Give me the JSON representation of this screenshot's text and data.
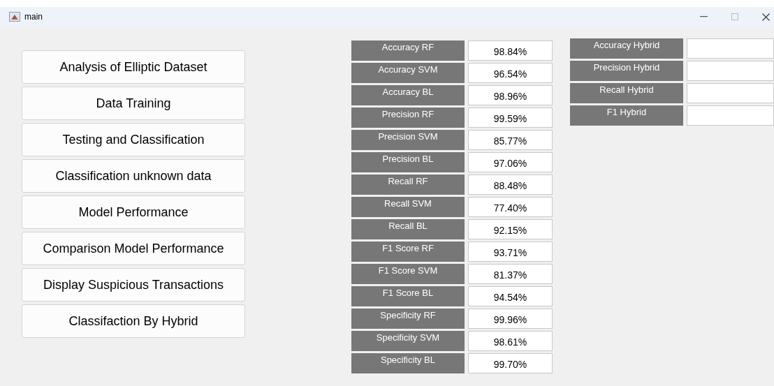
{
  "window": {
    "title": "main"
  },
  "buttons": [
    "Analysis of Elliptic Dataset",
    "Data Training",
    "Testing and Classification",
    "Classification  unknown data",
    "Model Performance",
    "Comparison Model Performance",
    "Display Suspicious Transactions",
    "Classifaction By Hybrid"
  ],
  "metrics": [
    {
      "label": "Accuracy RF",
      "value": "98.84%"
    },
    {
      "label": "Accuracy SVM",
      "value": "96.54%"
    },
    {
      "label": "Accuracy BL",
      "value": "98.96%"
    },
    {
      "label": "Precision RF",
      "value": "99.59%"
    },
    {
      "label": "Precision SVM",
      "value": "85.77%"
    },
    {
      "label": "Precision BL",
      "value": "97.06%"
    },
    {
      "label": "Recall RF",
      "value": "88.48%"
    },
    {
      "label": "Recall SVM",
      "value": "77.40%"
    },
    {
      "label": "Recall BL",
      "value": "92.15%"
    },
    {
      "label": "F1 Score RF",
      "value": "93.71%"
    },
    {
      "label": "F1 Score SVM",
      "value": "81.37%"
    },
    {
      "label": "F1 Score BL",
      "value": "94.54%"
    },
    {
      "label": "Specificity RF",
      "value": "99.96%"
    },
    {
      "label": "Specificity SVM",
      "value": "98.61%"
    },
    {
      "label": "Specificity BL",
      "value": "99.70%"
    }
  ],
  "hybrid_metrics": [
    {
      "label": "Accuracy Hybrid"
    },
    {
      "label": "Precision Hybrid"
    },
    {
      "label": "Recall Hybrid"
    },
    {
      "label": "F1 Hybrid"
    }
  ]
}
